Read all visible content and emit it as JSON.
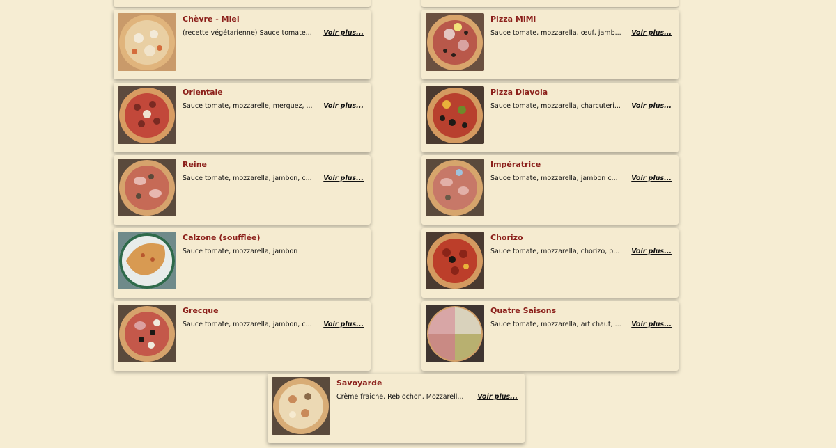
{
  "more_label": "Voir plus...",
  "pizzas": [
    {
      "name": "Chèvre - Miel",
      "desc": "(recette végétarienne) Sauce tomate...",
      "has_more": true,
      "photo": "pizza-goat-honey"
    },
    {
      "name": "Pizza MiMi",
      "desc": "Sauce tomate, mozzarella, œuf, jamb...",
      "has_more": true,
      "photo": "pizza-mimi"
    },
    {
      "name": "Orientale",
      "desc": "Sauce tomate, mozzarelle, merguez, ...",
      "has_more": true,
      "photo": "pizza-orientale"
    },
    {
      "name": "Pizza Diavola",
      "desc": "Sauce tomate, mozzarella, charcuteri...",
      "has_more": true,
      "photo": "pizza-diavola"
    },
    {
      "name": "Reine",
      "desc": "Sauce tomate, mozzarella, jambon, c...",
      "has_more": true,
      "photo": "pizza-reine"
    },
    {
      "name": "Impératrice",
      "desc": "Sauce tomate, mozzarella, jambon c...",
      "has_more": true,
      "photo": "pizza-imperatrice"
    },
    {
      "name": "Calzone (soufflée)",
      "desc": "Sauce tomate, mozzarella, jambon",
      "has_more": false,
      "photo": "pizza-calzone"
    },
    {
      "name": "Chorizo",
      "desc": "Sauce tomate, mozzarella, chorizo, p...",
      "has_more": true,
      "photo": "pizza-chorizo"
    },
    {
      "name": "Grecque",
      "desc": "Sauce tomate, mozzarella, jambon, c...",
      "has_more": true,
      "photo": "pizza-grecque"
    },
    {
      "name": "Quatre Saisons",
      "desc": "Sauce tomate, mozzarella, artichaut, ...",
      "has_more": true,
      "photo": "pizza-quatre-saisons"
    },
    {
      "name": "Savoyarde",
      "desc": "Crème fraîche, Reblochon, Mozzarell...",
      "has_more": true,
      "photo": "pizza-savoyarde"
    }
  ]
}
